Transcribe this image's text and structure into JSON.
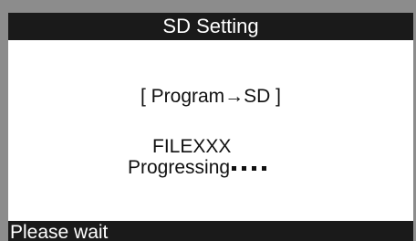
{
  "header": {
    "title": "SD Setting"
  },
  "main": {
    "operation": "[ Program→SD ]",
    "file_name": "FILEXXX",
    "progress_label": "Progressing",
    "progress_dots": "••••"
  },
  "footer": {
    "status": "Please wait"
  },
  "colors": {
    "bar_background": "#1a1a1a",
    "bar_text": "#ffffff",
    "screen_background": "#ffffff",
    "frame": "#8c8c8c"
  }
}
